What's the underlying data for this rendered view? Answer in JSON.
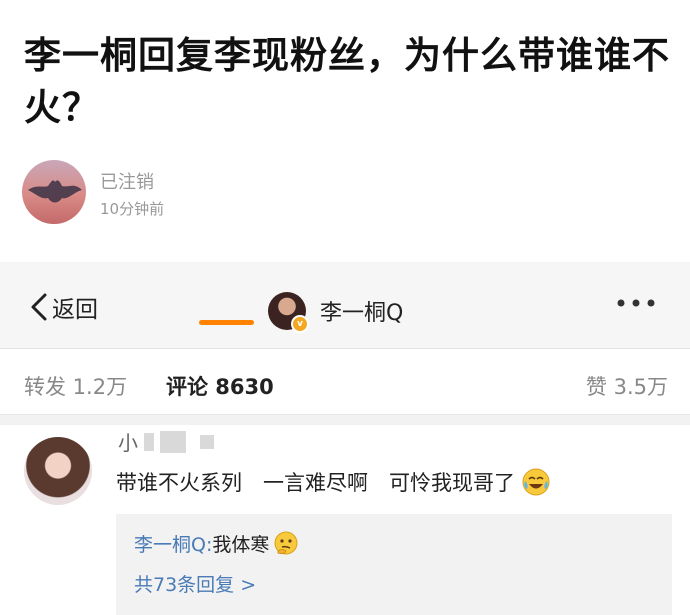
{
  "article": {
    "title": "李一桐回复李现粉丝，为什么带谁谁不火？",
    "author_name": "已注销",
    "time": "10分钟前"
  },
  "navbar": {
    "back_label": "返回",
    "user_name": "李一桐Q",
    "more_icon": "more-horizontal-icon",
    "back_icon": "chevron-left-icon"
  },
  "tabs": {
    "repost": "转发 1.2万",
    "comments": "评论 8630",
    "likes": "赞 3.5万",
    "accent_color": "#ff8200"
  },
  "comment": {
    "user_visible": "小",
    "text": "带谁不火系列　一言难尽啊　可怜我现哥了",
    "emoji": "crying-laughing-emoji",
    "reply": {
      "user": "李一桐Q:",
      "text": " 我体寒",
      "emoji": "thinking-emoji",
      "count_label": "共73条回复 >"
    }
  },
  "colors": {
    "link_blue": "#4a7bb7",
    "nav_bg": "#f6f6f6",
    "reply_bg": "#f2f2f2"
  }
}
